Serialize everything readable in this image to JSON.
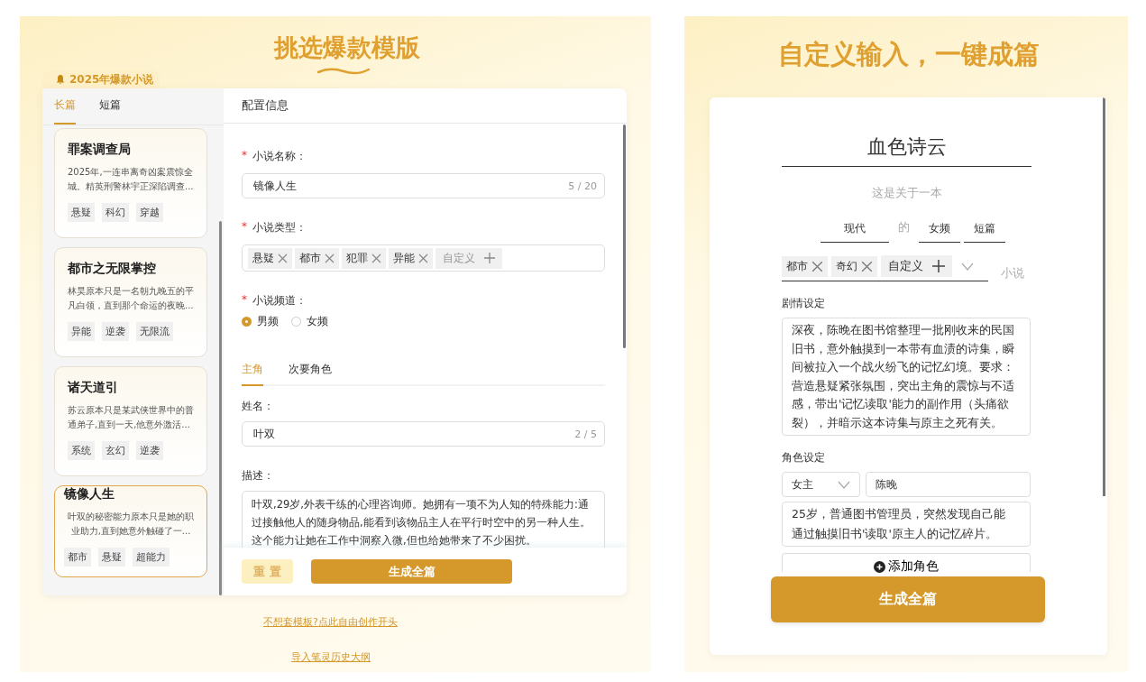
{
  "template_panel": {
    "title": "挑选爆款模版",
    "badge": "2025年爆款小说",
    "length_tabs": [
      {
        "label": "长篇",
        "selected": true
      },
      {
        "label": "短篇",
        "selected": false
      }
    ],
    "templates": [
      {
        "title": "罪案调查局",
        "summary": "2025年,一连串离奇凶案震惊全城。精英刑警林宇正深陷调查...",
        "tags": [
          "悬疑",
          "科幻",
          "穿越"
        ],
        "selected": false
      },
      {
        "title": "都市之无限掌控",
        "summary": "林昊原本只是一名朝九晚五的平凡白领，直到那个命运的夜晚...",
        "tags": [
          "异能",
          "逆袭",
          "无限流"
        ],
        "selected": false
      },
      {
        "title": "诸天道引",
        "summary": "苏云原本只是某武侠世界中的普通弟子,直到一天,他意外激活...",
        "tags": [
          "系统",
          "玄幻",
          "逆袭"
        ],
        "selected": false
      },
      {
        "title": "镜像人生",
        "summary": "叶双的秘密能力原本只是她的职业助力,直到她意外触碰了一...",
        "tags": [
          "都市",
          "悬疑",
          "超能力"
        ],
        "selected": true
      }
    ],
    "config": {
      "heading": "配置信息",
      "name_field": {
        "required_mark": "*",
        "label": "小说名称：",
        "value": "镜像人生",
        "counter": "5 / 20"
      },
      "type_field": {
        "required_mark": "*",
        "label": "小说类型：",
        "tags": [
          "悬疑",
          "都市",
          "犯罪",
          "异能"
        ],
        "custom": "自定义"
      },
      "channel_field": {
        "required_mark": "*",
        "label": "小说频道：",
        "options": [
          {
            "label": "男频",
            "selected": true
          },
          {
            "label": "女频",
            "selected": false
          }
        ]
      },
      "role_tabs": [
        {
          "label": "主角",
          "selected": true
        },
        {
          "label": "次要角色",
          "selected": false
        }
      ],
      "role_name": {
        "label": "姓名：",
        "value": "叶双",
        "counter": "2 / 5"
      },
      "role_desc": {
        "label": "描述：",
        "value": "叶双,29岁,外表干练的心理咨询师。她拥有一项不为人知的特殊能力:通过接触他人的随身物品,能看到该物品主人在平行时空中的另一种人生。这个能力让她在工作中洞察入微,但也给她带来了不少困扰。"
      },
      "reset_button": "重 置",
      "generate_button": "生成全篇"
    },
    "links": [
      "不想套模板?点此自由创作开头",
      "导入笔灵历史大纲"
    ]
  },
  "custom_panel": {
    "title": "自定义输入，一键成篇",
    "novel_title": "血色诗云",
    "intro": "这是关于一本",
    "era": "现代",
    "connector": "的",
    "channel": "女频",
    "length": "短篇",
    "tags": [
      "都市",
      "奇幻"
    ],
    "custom": "自定义",
    "suffix": "小说",
    "plot_label": "剧情设定",
    "plot": "深夜，陈晚在图书馆整理一批刚收来的民国旧书，意外触摸到一本带有血渍的诗集，瞬间被拉入一个战火纷飞的记忆幻境。要求：营造悬疑紧张氛围，突出主角的震惊与不适感，带出'记忆读取'能力的副作用（头痛欲裂），并暗示这本诗集与原主之死有关。",
    "role_label": "角色设定",
    "role_type": "女主",
    "role_name": "陈晚",
    "role_desc": "25岁，普通图书管理员，突然发现自己能通过触摸旧书'读取'原主人的记忆碎片。",
    "add_role": "添加角色",
    "generate_button": "生成全篇"
  }
}
